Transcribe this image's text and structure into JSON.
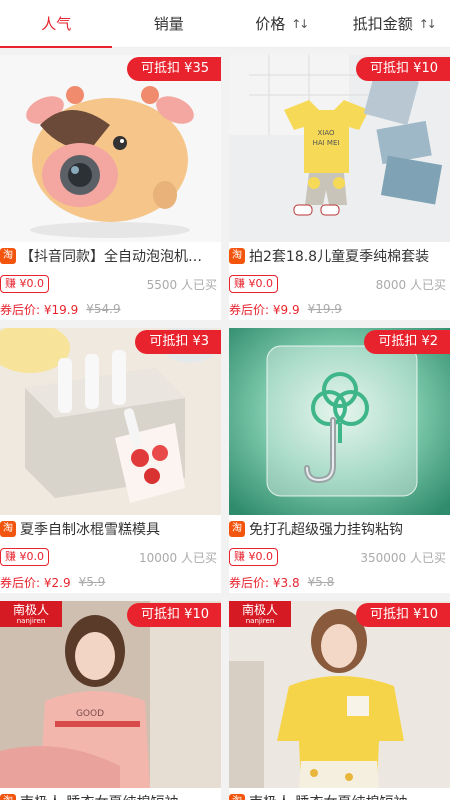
{
  "tabs": [
    {
      "label": "人气",
      "active": true
    },
    {
      "label": "销量",
      "active": false
    },
    {
      "label": "价格",
      "active": false,
      "sort_icon": "sort-arrows-icon"
    },
    {
      "label": "抵扣金额",
      "active": false,
      "sort_icon": "sort-arrows-icon"
    }
  ],
  "colors": {
    "accent": "#e8232e",
    "taobao_icon": "#f3550e"
  },
  "products": [
    {
      "badge": "可抵扣 ¥35",
      "title": "【抖音同款】全自动泡泡机…",
      "earn": "赚 ¥0.0",
      "sold": "5500 人已买",
      "price": "券后价: ¥19.9",
      "orig": "¥54.9",
      "platform_icon": "淘"
    },
    {
      "badge": "可抵扣 ¥10",
      "title": "拍2套18.8儿童夏季纯棉套装",
      "earn": "赚 ¥0.0",
      "sold": "8000 人已买",
      "price": "券后价: ¥9.9",
      "orig": "¥19.9",
      "platform_icon": "淘"
    },
    {
      "badge": "可抵扣 ¥3",
      "title": "夏季自制冰棍雪糕模具",
      "earn": "赚 ¥0.0",
      "sold": "10000 人已买",
      "price": "券后价: ¥2.9",
      "orig": "¥5.9",
      "platform_icon": "淘"
    },
    {
      "badge": "可抵扣 ¥2",
      "title": "免打孔超级强力挂钩粘钩",
      "earn": "赚 ¥0.0",
      "sold": "350000 人已买",
      "price": "券后价: ¥3.8",
      "orig": "¥5.8",
      "platform_icon": "淘"
    },
    {
      "badge": "可抵扣 ¥10",
      "title": "南极人 睡衣女夏纯棉短袖",
      "brand": "南极人",
      "brand_sub": "nanjiren",
      "platform_icon": "淘"
    },
    {
      "badge": "可抵扣 ¥10",
      "title": "南极人 睡衣女夏纯棉短袖",
      "brand": "南极人",
      "brand_sub": "nanjiren",
      "platform_icon": "淘"
    }
  ],
  "product_images": [
    "pig-bubble-machine",
    "kids-clothing-set",
    "popsicle-mold",
    "clear-adhesive-hook",
    "pajamas-pink",
    "pajamas-yellow"
  ]
}
